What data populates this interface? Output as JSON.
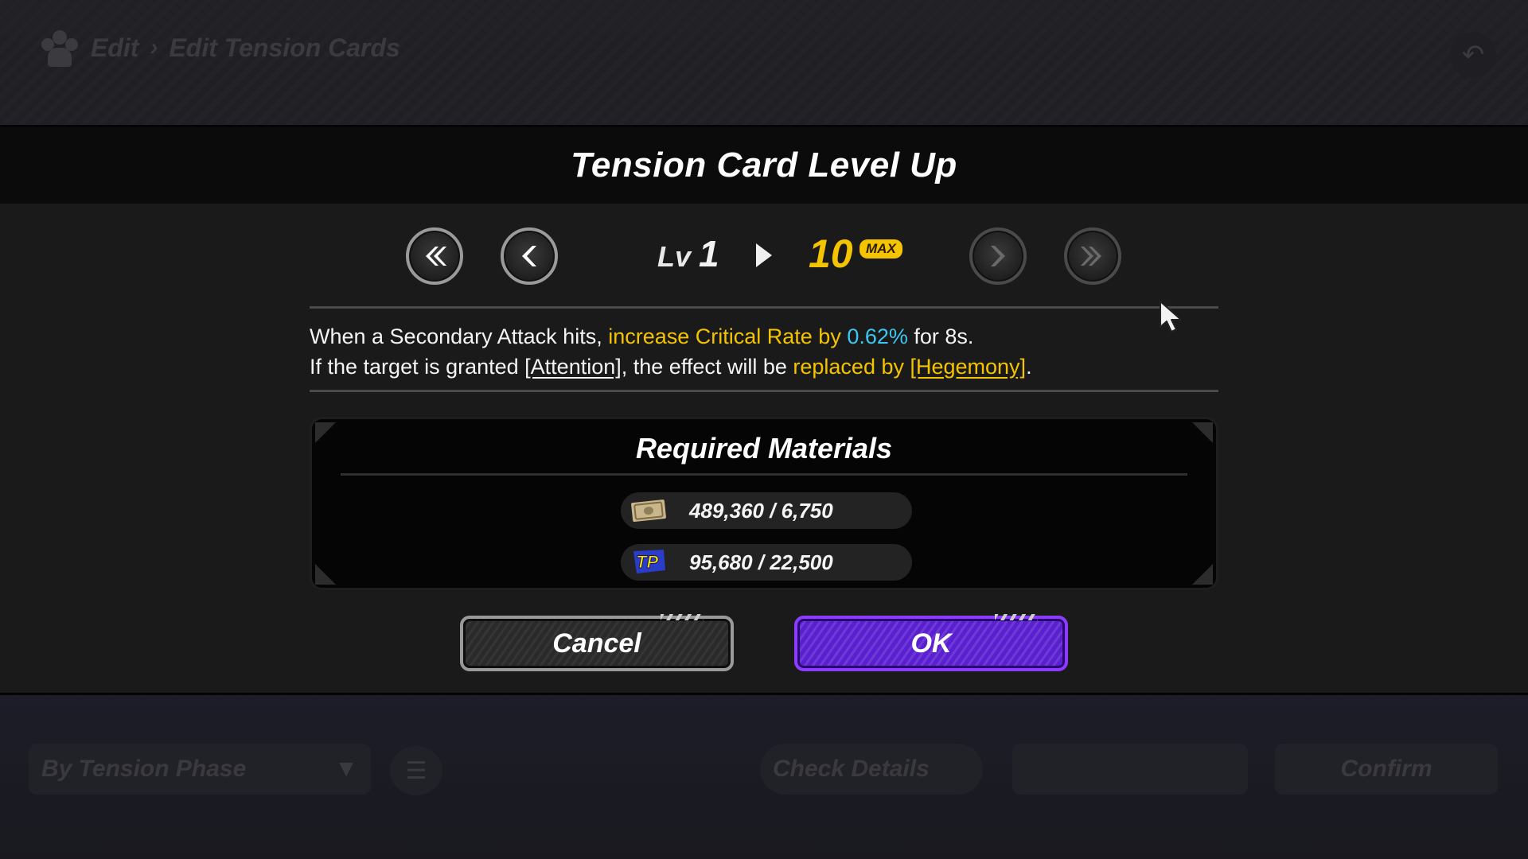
{
  "background": {
    "breadcrumb": [
      "Edit",
      "Edit Tension Cards"
    ],
    "sort_label": "By Tension Phase",
    "check_details_label": "Check Details",
    "confirm_label": "Confirm"
  },
  "modal": {
    "title": "Tension Card Level Up",
    "level": {
      "prefix": "Lv",
      "from": "1",
      "to": "10",
      "max_badge": "MAX"
    },
    "effect": {
      "line1": [
        {
          "text": "When a Secondary Attack hits, ",
          "style": "normal"
        },
        {
          "text": "increase Critical Rate by ",
          "style": "yellow"
        },
        {
          "text": "0.62%",
          "style": "cyan"
        },
        {
          "text": " for 8s.",
          "style": "normal"
        }
      ],
      "line2": [
        {
          "text": "If the target is granted ",
          "style": "normal"
        },
        {
          "text": "[Attention]",
          "style": "underline"
        },
        {
          "text": ", the effect will be ",
          "style": "normal"
        },
        {
          "text": "replaced by ",
          "style": "yellow"
        },
        {
          "text": "[Hegemony]",
          "style": "yellow-underline"
        },
        {
          "text": ".",
          "style": "normal"
        }
      ]
    },
    "materials": {
      "title": "Required Materials",
      "items": [
        {
          "icon": "money-bill-icon",
          "count": "489,360 / 6,750"
        },
        {
          "icon": "tp-icon",
          "count": "95,680 / 22,500"
        }
      ]
    },
    "cancel_label": "Cancel",
    "ok_label": "OK"
  },
  "colors": {
    "highlight_yellow": "#f5c400",
    "highlight_cyan": "#3cc8f0",
    "ok_purple": "#5a1fd0"
  }
}
